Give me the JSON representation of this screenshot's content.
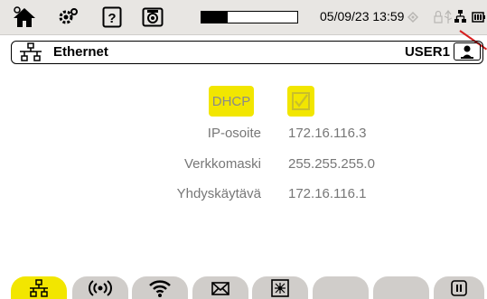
{
  "topbar": {
    "datetime": "05/09/23 13:59",
    "progress_fraction": 0.27,
    "icons": [
      "home-icon",
      "settings-icon",
      "help-icon",
      "camera-icon",
      "gps-icon",
      "lock-icon",
      "usb-icon",
      "network-icon",
      "battery-icon"
    ]
  },
  "header": {
    "title": "Ethernet",
    "user": "USER1",
    "title_icon": "ethernet-network-icon",
    "user_icon": "user-icon"
  },
  "form": {
    "dhcp_label": "DHCP",
    "dhcp_checked": true,
    "ip_label": "IP-osoite",
    "ip_value": "172.16.116.3",
    "mask_label": "Verkkomaski",
    "mask_value": "255.255.255.0",
    "gateway_label": "Yhdyskäytävä",
    "gateway_value": "172.16.116.1"
  },
  "tabs": [
    {
      "icon": "ethernet-icon",
      "active": true
    },
    {
      "icon": "wireless-broadcast-icon",
      "active": false
    },
    {
      "icon": "wifi-icon",
      "active": false
    },
    {
      "icon": "mail-icon",
      "active": false
    },
    {
      "icon": "server-network-icon",
      "active": false
    },
    {
      "icon": "",
      "active": false
    },
    {
      "icon": "",
      "active": false
    },
    {
      "icon": "pause-icon",
      "active": false
    }
  ],
  "colors": {
    "accent": "#f2e600",
    "topbar": "#e8e6e3",
    "tab": "#d0cdca",
    "text_muted": "#777777"
  }
}
